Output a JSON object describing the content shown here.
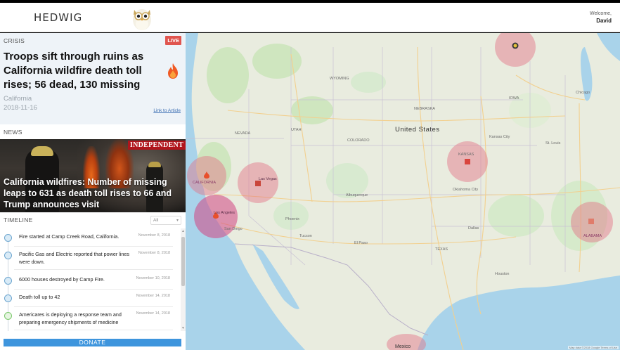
{
  "header": {
    "brand": "HEDWIG",
    "welcome_label": "Welcome,",
    "user_name": "David"
  },
  "crisis": {
    "section_label": "CRISIS",
    "live_badge": "LIVE",
    "title": "Troops sift through ruins as California wildfire death toll rises; 56 dead, 130 missing",
    "location": "California",
    "date": "2018-11-16",
    "link_label": "Link to Article"
  },
  "news": {
    "section_label": "NEWS",
    "source": "INDEPENDENT",
    "headline": "California wildfires: Number of missing leaps to 631 as death toll rises to 66 and Trump announces visit"
  },
  "timeline": {
    "section_label": "TIMELINE",
    "filter_value": "All",
    "items": [
      {
        "text": "Fire started at Camp Creek Road, California.",
        "date": "November 8, 2018"
      },
      {
        "text": "Pacific Gas and Electric reported that power lines were down.",
        "date": "November 8, 2018"
      },
      {
        "text": "6000 houses destroyed by Camp Fire.",
        "date": "November 10, 2018"
      },
      {
        "text": "Death toll up to 42",
        "date": "November 14, 2018"
      },
      {
        "text": "Americares is deploying a response team and preparing emergency shipments of medicine",
        "date": "November 14, 2018"
      }
    ]
  },
  "donate_label": "DONATE",
  "map": {
    "country_label": "United States",
    "place_labels": {
      "california": "CALIFORNIA",
      "las_vegas": "Las Vegas",
      "los_angeles": "Los Angeles",
      "san_diego": "San Diego",
      "phoenix": "Phoenix",
      "tucson": "Tucson",
      "el_paso": "El Paso",
      "albuquerque": "Albuquerque",
      "kansas": "KANSAS",
      "kansas_city": "Kansas City",
      "oklahoma_city": "Oklahoma City",
      "dallas": "Dallas",
      "houston": "Houston",
      "chicago": "Chicago",
      "st_louis": "St. Louis",
      "alabama": "ALABAMA",
      "mexico": "Mexico",
      "wyoming": "WYOMING",
      "colorado": "COLORADO",
      "nebraska": "NEBRASKA",
      "iowa": "IOWA",
      "utah": "UTAH",
      "nevada": "NEVADA",
      "texas": "TEXAS"
    },
    "attribution": "Map data ©2018 Google  Terms of Use",
    "colors": {
      "land": "#e9ecdf",
      "water": "#a9d3ea",
      "park": "#cfe6bf",
      "hotspot": "#e27084",
      "road": "#f2d08f"
    }
  }
}
